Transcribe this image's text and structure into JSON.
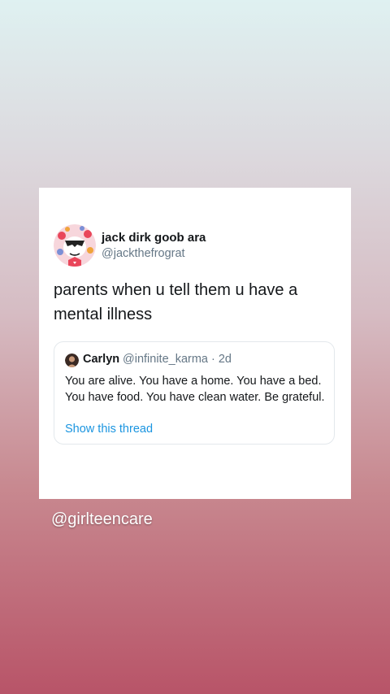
{
  "tweet": {
    "display_name": "jack dirk goob ara",
    "handle": "@jackthefrograt",
    "text": "parents when u tell them u have a mental illness",
    "avatar_icon": "cartoon-avatar-icon"
  },
  "quoted_tweet": {
    "name": "Carlyn",
    "meta": "@infinite_karma · 2d",
    "text": "You are alive. You have a home. You have a bed. You have food. You have clean water. Be grateful.",
    "link_label": "Show this thread",
    "avatar_icon": "profile-photo-icon"
  },
  "credit": {
    "label": "@girlteencare"
  },
  "colors": {
    "text_primary": "#14171a",
    "text_secondary": "#657786",
    "link": "#1b95e0",
    "gradient_top": "#dff1f1",
    "gradient_bottom": "#b85468"
  }
}
